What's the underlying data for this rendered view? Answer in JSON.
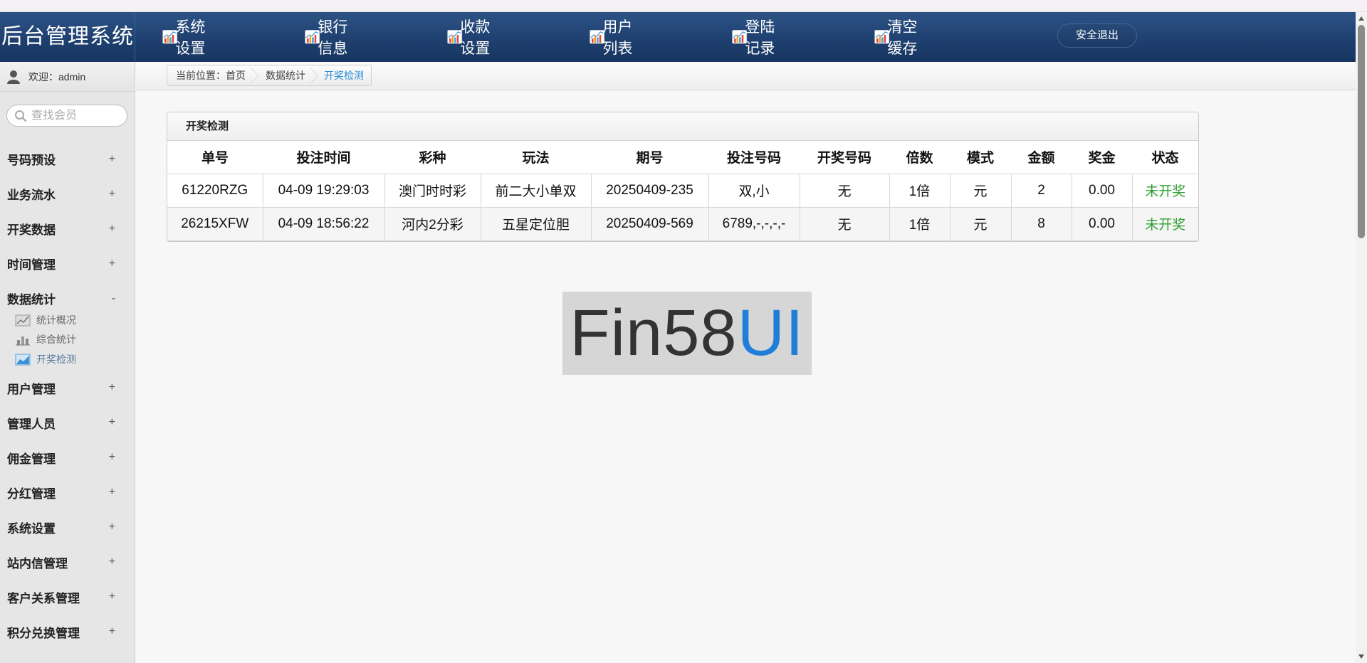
{
  "app": {
    "title": "后台管理系统"
  },
  "topnav": {
    "items": [
      {
        "label": "系统设置",
        "icon": "chart-icon"
      },
      {
        "label": "银行信息",
        "icon": "chart-icon"
      },
      {
        "label": "收款设置",
        "icon": "chart-icon"
      },
      {
        "label": "用户列表",
        "icon": "chart-icon"
      },
      {
        "label": "登陆记录",
        "icon": "chart-icon"
      },
      {
        "label": "清空缓存",
        "icon": "chart-icon"
      }
    ],
    "logout_label": "安全退出"
  },
  "sidebar": {
    "welcome": "欢迎：admin",
    "search_placeholder": "查找会员",
    "menu": [
      {
        "label": "号码预设",
        "toggle": "+"
      },
      {
        "label": "业务流水",
        "toggle": "+"
      },
      {
        "label": "开奖数据",
        "toggle": "+"
      },
      {
        "label": "时间管理",
        "toggle": "+"
      },
      {
        "label": "数据统计",
        "toggle": "-"
      },
      {
        "label": "用户管理",
        "toggle": "+"
      },
      {
        "label": "管理人员",
        "toggle": "+"
      },
      {
        "label": "佣金管理",
        "toggle": "+"
      },
      {
        "label": "分红管理",
        "toggle": "+"
      },
      {
        "label": "系统设置",
        "toggle": "+"
      },
      {
        "label": "站内信管理",
        "toggle": "+"
      },
      {
        "label": "客户关系管理",
        "toggle": "+"
      },
      {
        "label": "积分兑换管理",
        "toggle": "+"
      }
    ],
    "submenu": [
      {
        "label": "统计概况"
      },
      {
        "label": "综合统计"
      },
      {
        "label": "开奖检测"
      }
    ]
  },
  "breadcrumb": {
    "prefix": "当前位置：首页",
    "middle": "数据统计",
    "current": "开奖检测"
  },
  "panel": {
    "title": "开奖检测",
    "columns": [
      "单号",
      "投注时间",
      "彩种",
      "玩法",
      "期号",
      "投注号码",
      "开奖号码",
      "倍数",
      "模式",
      "金额",
      "奖金",
      "状态"
    ],
    "rows": [
      [
        "61220RZG",
        "04-09 19:29:03",
        "澳门时时彩",
        "前二大小单双",
        "20250409-235",
        "双,小",
        "无",
        "1倍",
        "元",
        "2",
        "0.00",
        "未开奖"
      ],
      [
        "26215XFW",
        "04-09 18:56:22",
        "河内2分彩",
        "五星定位胆",
        "20250409-569",
        "6789,-,-,-,-",
        "无",
        "1倍",
        "元",
        "8",
        "0.00",
        "未开奖"
      ]
    ]
  },
  "watermark": {
    "part1": "Fin58",
    "part2": "UI"
  },
  "colors": {
    "header": "#1e3f6e",
    "status_pending": "#2f9e2f",
    "breadcrumb_active": "#2b8fd6"
  }
}
